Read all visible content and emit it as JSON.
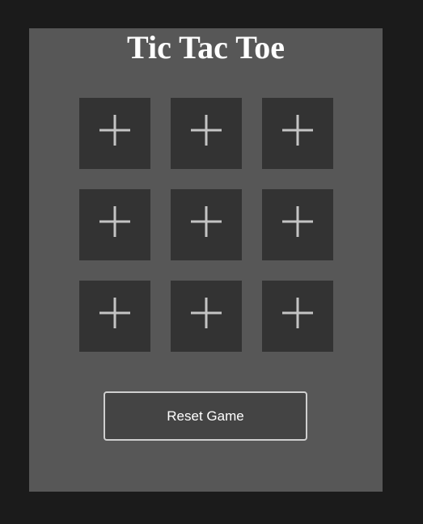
{
  "game": {
    "title": "Tic Tac Toe",
    "board": [
      [
        "empty",
        "empty",
        "empty"
      ],
      [
        "empty",
        "empty",
        "empty"
      ],
      [
        "empty",
        "empty",
        "empty"
      ]
    ],
    "cell_icon": "plus-icon",
    "reset_label": "Reset Game"
  },
  "colors": {
    "page_background": "#1b1b1b",
    "panel_background": "#575757",
    "cell_background": "#333333",
    "icon_color": "#c4c4c4",
    "button_background": "#444444",
    "button_border": "#cfcfcf",
    "text_color": "#ffffff"
  }
}
